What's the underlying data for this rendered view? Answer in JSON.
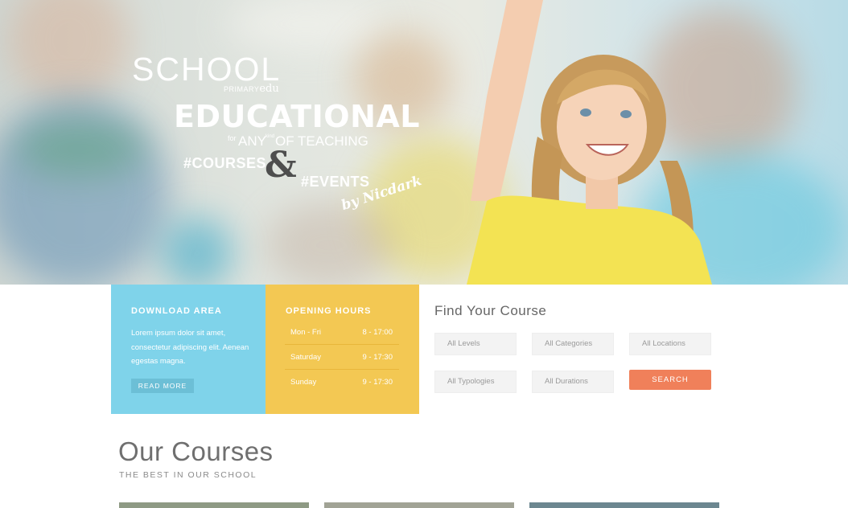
{
  "hero": {
    "logo_school": "SCHOOL",
    "logo_primary": "PRIMARY",
    "logo_edu": "edu",
    "title": "EDUCATIONAL",
    "tag_for": "for",
    "tag_any": "ANY",
    "tag_kind": "kind",
    "tag_of_teaching": "OF TEACHING",
    "courses_tag": "#COURSES",
    "ampersand": "&",
    "events_tag": "#EVENTS",
    "by_line": "by Nicdark"
  },
  "download_area": {
    "title": "DOWNLOAD AREA",
    "text": "Lorem ipsum dolor sit amet, consectetur adipiscing elit. Aenean egestas magna.",
    "button_label": "READ MORE"
  },
  "opening_hours": {
    "title": "OPENING HOURS",
    "rows": [
      {
        "day": "Mon - Fri",
        "time": "8 - 17:00"
      },
      {
        "day": "Saturday",
        "time": "9 - 17:30"
      },
      {
        "day": "Sunday",
        "time": "9 - 17:30"
      }
    ]
  },
  "find_course": {
    "title": "Find Your Course",
    "selects": {
      "levels": "All Levels",
      "categories": "All Categories",
      "locations": "All Locations",
      "typologies": "All Typologies",
      "durations": "All Durations"
    },
    "search_label": "SEARCH"
  },
  "our_courses": {
    "title": "Our Courses",
    "subtitle": "THE BEST IN OUR SCHOOL"
  },
  "colors": {
    "download_bg": "#7fd3ea",
    "hours_bg": "#f3c853",
    "search_btn": "#f0805a"
  }
}
